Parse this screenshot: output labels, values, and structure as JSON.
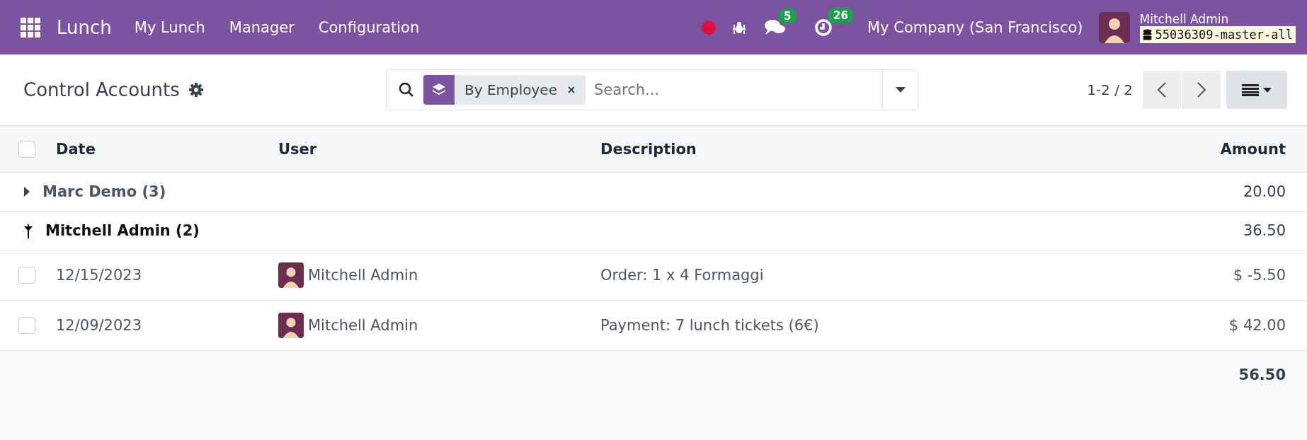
{
  "navbar": {
    "app_name": "Lunch",
    "menu": [
      "My Lunch",
      "Manager",
      "Configuration"
    ],
    "messages_count": "5",
    "activities_count": "26",
    "company": "My Company (San Francisco)",
    "user_name": "Mitchell Admin",
    "database": "55036309-master-all"
  },
  "control_panel": {
    "title": "Control Accounts",
    "facet": "By Employee",
    "search_placeholder": "Search...",
    "pager": "1-2 / 2"
  },
  "table": {
    "select_all_checked": false,
    "columns": [
      "Date",
      "User",
      "Description",
      "Amount"
    ],
    "groups": [
      {
        "label": "Marc Demo (3)",
        "total": "20.00",
        "expanded": false
      },
      {
        "label": "Mitchell Admin (2)",
        "total": "36.50",
        "expanded": true,
        "rows": [
          {
            "date": "12/15/2023",
            "user": "Mitchell Admin",
            "description": "Order: 1 x 4 Formaggi",
            "amount": "$ -5.50",
            "checked": false
          },
          {
            "date": "12/09/2023",
            "user": "Mitchell Admin",
            "description": "Payment: 7 lunch tickets (6€)",
            "amount": "$ 42.00",
            "checked": false
          }
        ]
      }
    ],
    "grand_total": "56.50"
  }
}
